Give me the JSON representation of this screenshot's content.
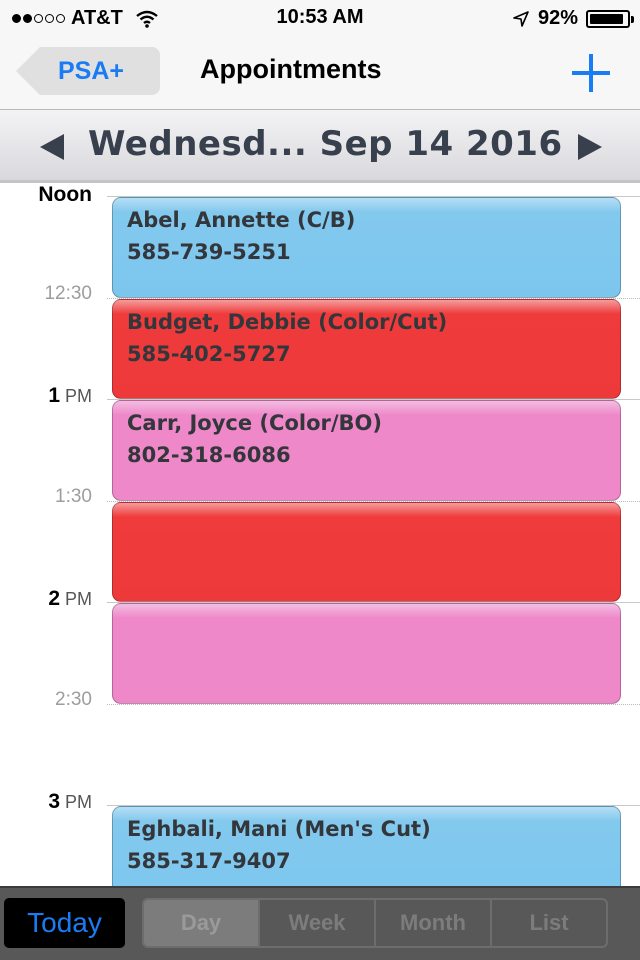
{
  "status_bar": {
    "signal_bars_filled": 2,
    "signal_bars_total": 5,
    "carrier": "AT&T",
    "time": "10:53 AM",
    "battery_percent_label": "92%",
    "battery_level": 0.92,
    "icons": [
      "signal-dots-icon",
      "wifi-icon",
      "location-arrow-icon",
      "battery-icon"
    ]
  },
  "nav": {
    "back_label": "PSA+",
    "title": "Appointments",
    "add_icon": "plus-icon"
  },
  "date_bar": {
    "prev_icon": "triangle-left-icon",
    "date_label": "Wednesd... Sep 14 2016",
    "next_icon": "triangle-right-icon"
  },
  "timeline": {
    "labels": [
      {
        "kind": "hour",
        "main": "Noon",
        "suffix": ""
      },
      {
        "kind": "half",
        "main": "12:30",
        "suffix": ""
      },
      {
        "kind": "hour",
        "main": "1",
        "suffix": "PM"
      },
      {
        "kind": "half",
        "main": "1:30",
        "suffix": ""
      },
      {
        "kind": "hour",
        "main": "2",
        "suffix": "PM"
      },
      {
        "kind": "half",
        "main": "2:30",
        "suffix": ""
      },
      {
        "kind": "hour",
        "main": "3",
        "suffix": "PM"
      }
    ],
    "appointments": [
      {
        "name": "Abel, Annette (C/B)",
        "phone": "585-739-5251",
        "color": "blue",
        "start": "12:00",
        "end": "12:30"
      },
      {
        "name": "Budget, Debbie (Color/Cut)",
        "phone": "585-402-5727",
        "color": "red",
        "start": "12:30",
        "end": "13:00"
      },
      {
        "name": "Carr, Joyce (Color/BO)",
        "phone": "802-318-6086",
        "color": "pink",
        "start": "13:00",
        "end": "13:30"
      },
      {
        "name": "",
        "phone": "",
        "color": "red",
        "start": "13:30",
        "end": "14:00"
      },
      {
        "name": "",
        "phone": "",
        "color": "pink",
        "start": "14:00",
        "end": "14:30"
      },
      {
        "name": "Eghbali, Mani (Men's Cut)",
        "phone": "585-317-9407",
        "color": "blue",
        "start": "15:00",
        "end": "15:30"
      }
    ],
    "colors": {
      "blue": "#7cc6ee",
      "red": "#ee393a",
      "pink": "#ee88c9"
    }
  },
  "toolbar": {
    "today_label": "Today",
    "segments": [
      "Day",
      "Week",
      "Month",
      "List"
    ],
    "selected_segment": "Day"
  }
}
